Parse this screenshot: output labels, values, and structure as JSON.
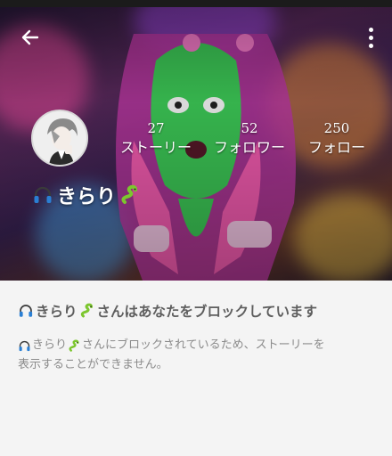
{
  "profile": {
    "name": "きらり",
    "name_emoji_prefix": "headphones-icon",
    "name_emoji_suffix": "snake-icon"
  },
  "header": {
    "back_icon": "arrow-left-icon",
    "more_icon": "more-vertical-icon"
  },
  "stats": [
    {
      "count": "27",
      "label": "ストーリー"
    },
    {
      "count": "52",
      "label": "フォロワー"
    },
    {
      "count": "250",
      "label": "フォロー"
    }
  ],
  "blocked": {
    "title_suffix": "さんはあなたをブロックしています",
    "body_line1_suffix": "さんにブロックされているため、ストーリーを",
    "body_line2": "表示することができません。"
  },
  "colors": {
    "title_text": "#5e5e5e",
    "body_text": "#8b8b8b",
    "panel_bg": "#f4f4f4"
  }
}
